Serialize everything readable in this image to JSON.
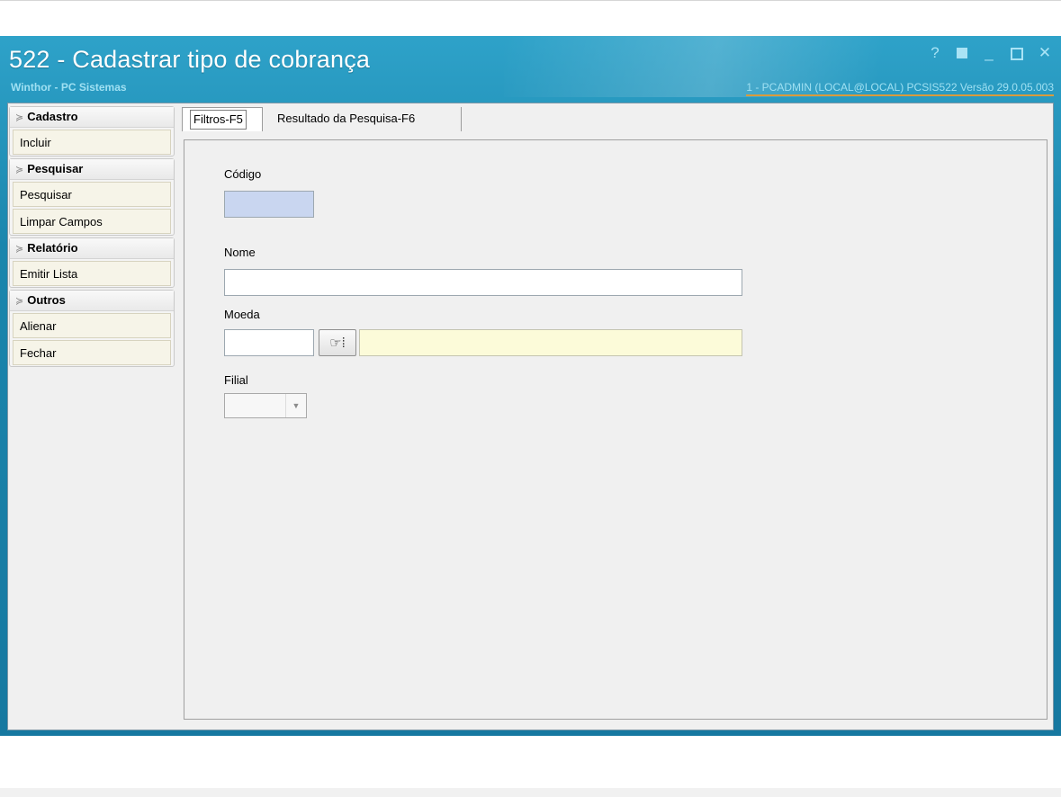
{
  "window": {
    "title": "522 - Cadastrar tipo de cobrança",
    "subtitle": "Winthor - PC Sistemas",
    "status": "1 - PCADMIN (LOCAL@LOCAL)  PCSIS522  Versão  29.0.05.003",
    "controls": {
      "help": "?",
      "minimize": "_",
      "close": "✕"
    }
  },
  "sidebar": {
    "groups": [
      {
        "title": "Cadastro",
        "items": [
          "Incluir"
        ]
      },
      {
        "title": "Pesquisar",
        "items": [
          "Pesquisar",
          "Limpar Campos"
        ]
      },
      {
        "title": "Relatório",
        "items": [
          "Emitir Lista"
        ]
      },
      {
        "title": "Outros",
        "items": [
          "Alienar",
          "Fechar"
        ]
      }
    ]
  },
  "tabs": [
    {
      "label": "Filtros-F5",
      "active": true
    },
    {
      "label": "Resultado da Pesquisa-F6",
      "active": false
    }
  ],
  "form": {
    "codigo": {
      "label": "Código",
      "value": ""
    },
    "nome": {
      "label": "Nome",
      "value": ""
    },
    "moeda": {
      "label": "Moeda",
      "code": "",
      "description": ""
    },
    "filial": {
      "label": "Filial",
      "value": ""
    }
  },
  "colors": {
    "titlebar": "#1b86ad",
    "codigo_field": "#c9d6f0",
    "moeda_description_field": "#fcfbd9",
    "sidebar_button": "#f6f4e8",
    "status_underline": "#d89b3d"
  },
  "icons": {
    "lookup": "pointing-hand-icon",
    "group_toggle": "chevron-double-down-icon"
  }
}
